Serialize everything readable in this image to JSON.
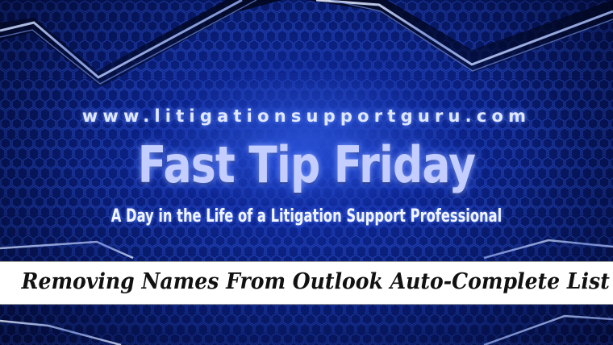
{
  "banner": {
    "url": "www.litigationsupportguru.com",
    "title": "Fast Tip Friday",
    "subtitle": "A Day in the Life of a Litigation Support Professional"
  },
  "caption": {
    "text": "Removing Names From Outlook Auto-Complete List"
  },
  "colors": {
    "background_dark": "#020c3a",
    "background_glow": "#0f2a9a",
    "title_text": "#c3cdff",
    "caption_background": "#ffffff",
    "caption_text": "#111111"
  }
}
